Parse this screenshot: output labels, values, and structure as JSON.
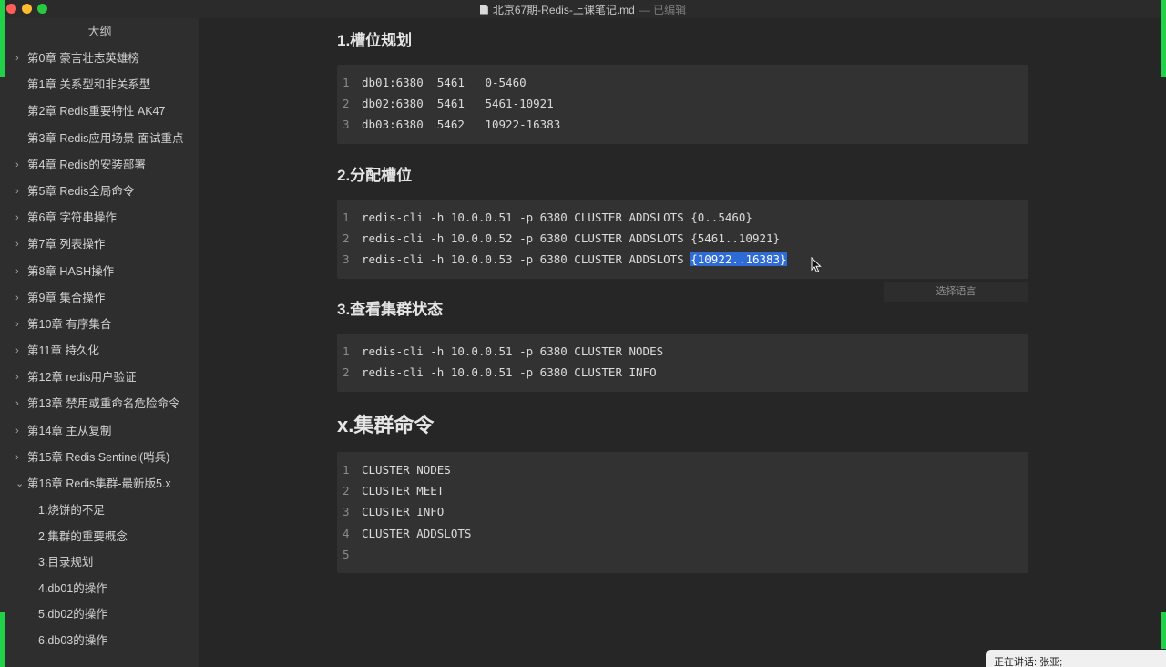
{
  "window": {
    "title": "北京67期-Redis-上课笔记.md",
    "title_status": "— 已编辑"
  },
  "sidebar": {
    "header": "大纲",
    "items": [
      {
        "label": "第0章 豪言壮志英雄榜",
        "arrow": "›"
      },
      {
        "label": "第1章 关系型和非关系型",
        "arrow": ""
      },
      {
        "label": "第2章 Redis重要特性 AK47",
        "arrow": ""
      },
      {
        "label": "第3章 Redis应用场景-面试重点",
        "arrow": ""
      },
      {
        "label": "第4章 Redis的安装部署",
        "arrow": "›"
      },
      {
        "label": "第5章 Redis全局命令",
        "arrow": "›"
      },
      {
        "label": "第6章 字符串操作",
        "arrow": "›"
      },
      {
        "label": "第7章 列表操作",
        "arrow": "›"
      },
      {
        "label": "第8章 HASH操作",
        "arrow": "›"
      },
      {
        "label": "第9章 集合操作",
        "arrow": "›"
      },
      {
        "label": "第10章 有序集合",
        "arrow": "›"
      },
      {
        "label": "第11章 持久化",
        "arrow": "›"
      },
      {
        "label": "第12章 redis用户验证",
        "arrow": "›"
      },
      {
        "label": "第13章 禁用或重命名危险命令",
        "arrow": "›"
      },
      {
        "label": "第14章 主从复制",
        "arrow": "›"
      },
      {
        "label": "第15章 Redis Sentinel(哨兵)",
        "arrow": "›"
      },
      {
        "label": "第16章 Redis集群-最新版5.x",
        "arrow": "⌄"
      }
    ],
    "subitems": [
      {
        "label": "1.烧饼的不足"
      },
      {
        "label": "2.集群的重要概念"
      },
      {
        "label": "3.目录规划"
      },
      {
        "label": "4.db01的操作"
      },
      {
        "label": "5.db02的操作"
      },
      {
        "label": "6.db03的操作"
      }
    ]
  },
  "sections": [
    {
      "heading": "1.槽位规划",
      "lines": [
        {
          "n": "1",
          "text": "db01:6380  5461   0-5460"
        },
        {
          "n": "2",
          "text": "db02:6380  5461   5461-10921"
        },
        {
          "n": "3",
          "text": "db03:6380  5462   10922-16383"
        }
      ]
    },
    {
      "heading": "2.分配槽位",
      "lines": [
        {
          "n": "1",
          "text": "redis-cli -h 10.0.0.51 -p 6380 CLUSTER ADDSLOTS {0..5460}"
        },
        {
          "n": "2",
          "text": "redis-cli -h 10.0.0.52 -p 6380 CLUSTER ADDSLOTS {5461..10921}"
        },
        {
          "n": "3",
          "text": "redis-cli -h 10.0.0.53 -p 6380 CLUSTER ADDSLOTS ",
          "selected": "{10922..16383}"
        }
      ],
      "lang_button": "选择语言"
    },
    {
      "heading": "3.查看集群状态",
      "lines": [
        {
          "n": "1",
          "text": "redis-cli -h 10.0.0.51 -p 6380 CLUSTER NODES"
        },
        {
          "n": "2",
          "text": "redis-cli -h 10.0.0.51 -p 6380 CLUSTER INFO"
        }
      ]
    },
    {
      "heading": "x.集群命令",
      "lines": [
        {
          "n": "1",
          "text": "CLUSTER NODES"
        },
        {
          "n": "2",
          "text": "CLUSTER MEET"
        },
        {
          "n": "3",
          "text": "CLUSTER INFO"
        },
        {
          "n": "4",
          "text": "CLUSTER ADDSLOTS"
        },
        {
          "n": "5",
          "text": ""
        }
      ]
    }
  ],
  "overlay": {
    "speaking": "正在讲话: 张亚;"
  },
  "colors": {
    "accent_green": "#21d14a",
    "selection_blue": "#2f6bd6"
  }
}
